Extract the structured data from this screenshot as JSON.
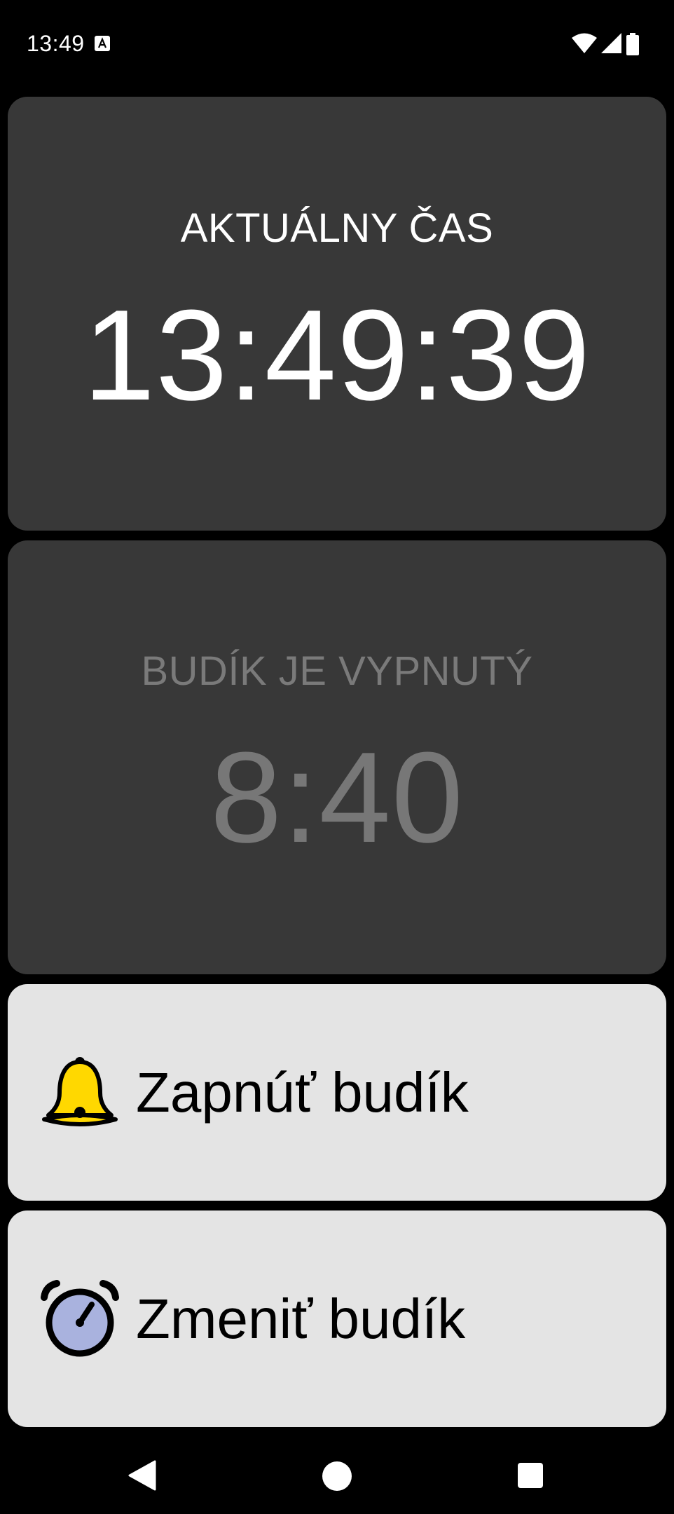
{
  "status_bar": {
    "time": "13:49",
    "icons": [
      "text-a-icon",
      "wifi-icon",
      "cell-signal-icon",
      "battery-icon"
    ]
  },
  "current_time_card": {
    "label": "AKTUÁLNY ČAS",
    "time": "13:49:39"
  },
  "alarm_card": {
    "status": "BUDÍK JE VYPNUTÝ",
    "time": "8:40"
  },
  "actions": {
    "enable_alarm": {
      "label": "Zapnúť budík",
      "icon": "bell-icon"
    },
    "change_alarm": {
      "label": "Zmeniť budík",
      "icon": "alarm-clock-icon"
    }
  },
  "nav_bar": {
    "icons": [
      "back-icon",
      "home-icon",
      "recents-icon"
    ]
  },
  "colors": {
    "background": "#000000",
    "dark_card": "#383838",
    "light_card": "#e4e4e4",
    "bell_yellow": "#ffd800",
    "clock_face": "#a9b2de",
    "disabled_text": "#777777"
  }
}
